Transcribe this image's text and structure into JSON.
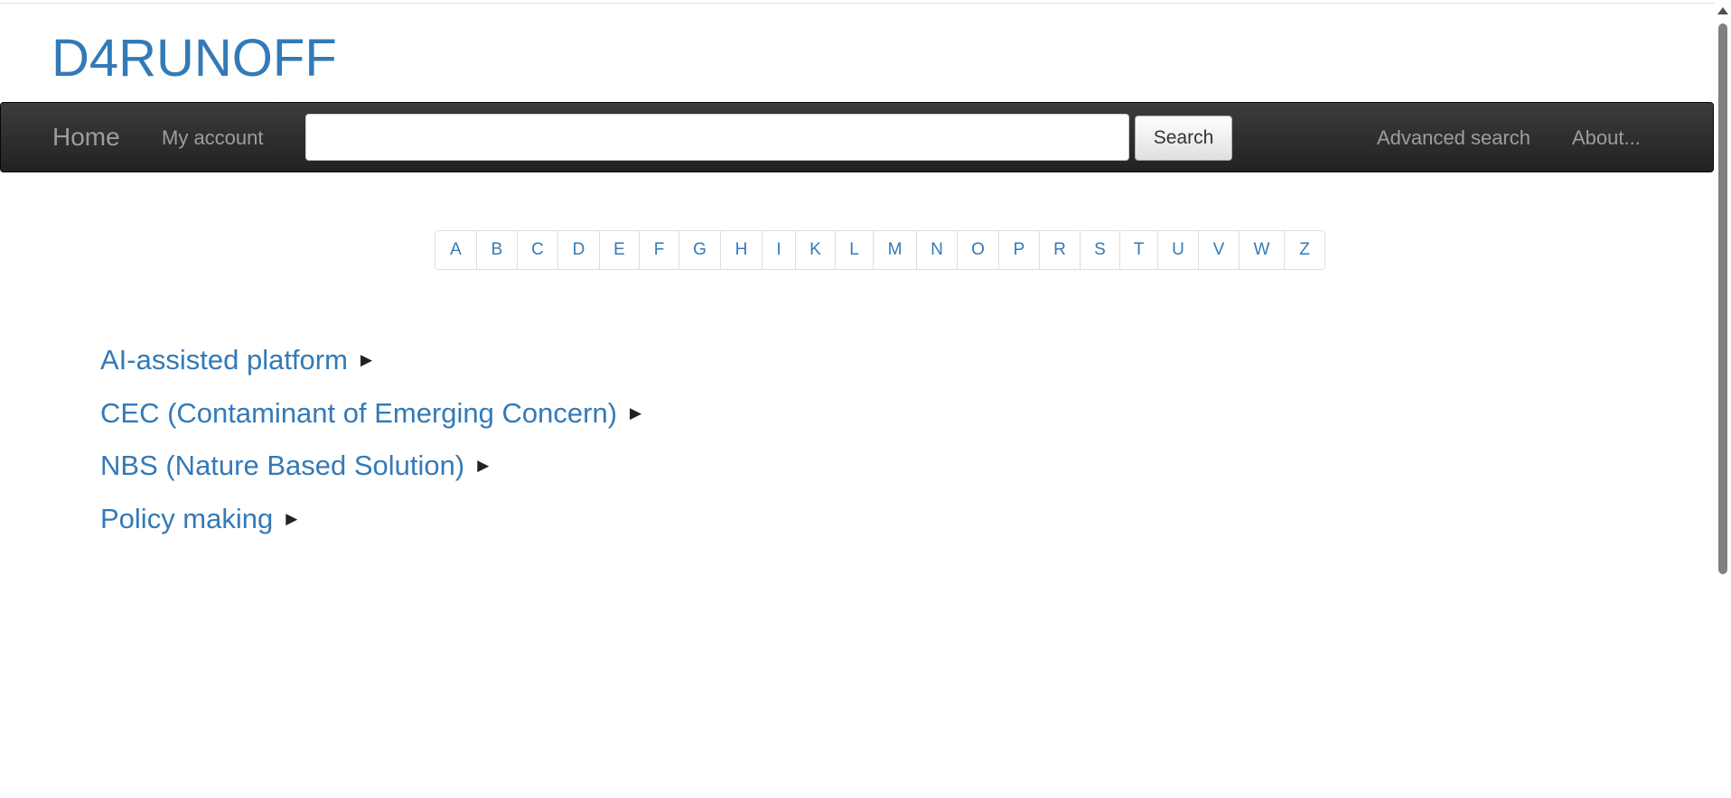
{
  "site": {
    "title": "D4RUNOFF"
  },
  "navbar": {
    "home_label": "Home",
    "account_label": "My account",
    "search_value": "",
    "search_button_label": "Search",
    "advanced_search_label": "Advanced search",
    "about_label": "About..."
  },
  "alphabet": [
    "A",
    "B",
    "C",
    "D",
    "E",
    "F",
    "G",
    "H",
    "I",
    "K",
    "L",
    "M",
    "N",
    "O",
    "P",
    "R",
    "S",
    "T",
    "U",
    "V",
    "W",
    "Z"
  ],
  "topics": [
    {
      "label": "AI-assisted platform",
      "expander": "▶"
    },
    {
      "label": "CEC (Contaminant of Emerging Concern)",
      "expander": "▶"
    },
    {
      "label": "NBS (Nature Based Solution)",
      "expander": "▶"
    },
    {
      "label": "Policy making",
      "expander": "▶"
    }
  ],
  "colors": {
    "link": "#337ab7",
    "navbar_background": "#222222",
    "navbar_text": "#9d9d9d"
  }
}
